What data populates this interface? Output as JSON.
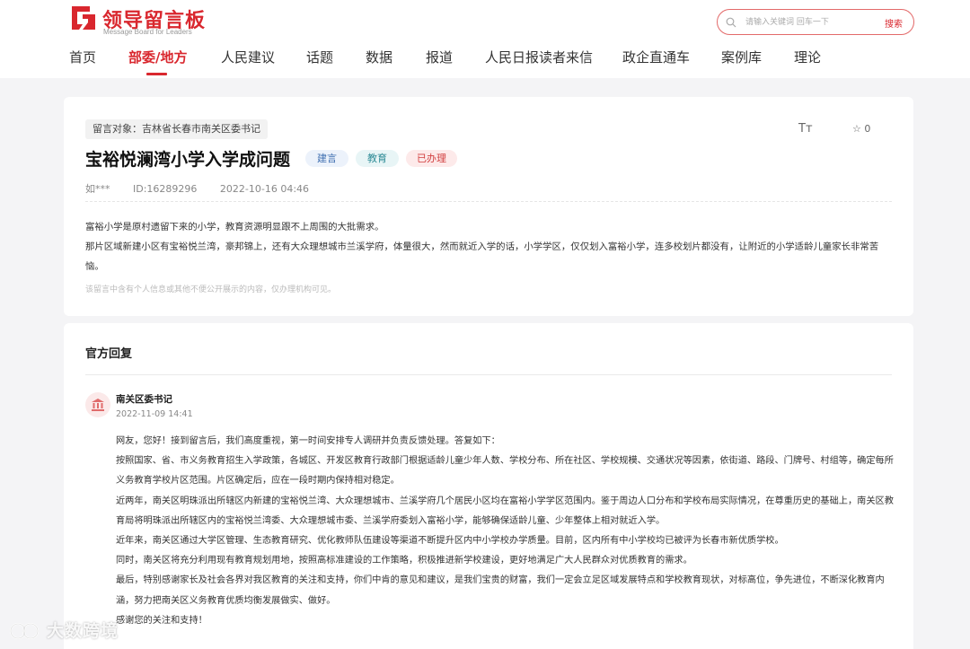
{
  "brand": {
    "name": "领导留言板",
    "subtitle": "Message Board for Leaders",
    "color": "#d9272e"
  },
  "search": {
    "placeholder": "请输入关键词 回车一下",
    "button": "搜索"
  },
  "nav": {
    "items": [
      "首页",
      "部委/地方",
      "人民建议",
      "话题",
      "数据",
      "报道",
      "人民日报读者来信",
      "政企直通车",
      "案例库",
      "理论"
    ],
    "active": "部委/地方"
  },
  "message": {
    "target": "留言对象：吉林省长春市南关区委书记",
    "font_size_icon": "Tт",
    "star_count": "☆ 0",
    "title": "宝裕悦澜湾小学入学成问题",
    "tags": [
      "建言",
      "教育",
      "已办理"
    ],
    "author": "如***",
    "id": "ID:16289296",
    "time": "2022-10-16 04:46",
    "paragraphs": [
      "富裕小学是原村遗留下来的小学，教育资源明显跟不上周围的大批需求。",
      "那片区域新建小区有宝裕悦兰湾，豪邦锦上，还有大众理想城市兰溪学府，体量很大，然而就近入学的话，小学学区，仅仅划入富裕小学，连多校划片都没有，让附近的小学适龄儿童家长非常苦恼。"
    ],
    "privacy_note": "该留言中含有个人信息或其他不便公开展示的内容，仅办理机构可见。"
  },
  "reply": {
    "section_title": "官方回复",
    "replier": "南关区委书记",
    "time": "2022-11-09 14:41",
    "paragraphs": [
      "网友，您好！接到留言后，我们高度重视，第一时间安排专人调研并负责反馈处理。答复如下：",
      "按照国家、省、市义务教育招生入学政策，各城区、开发区教育行政部门根据适龄儿童少年人数、学校分布、所在社区、学校规模、交通状况等因素，依街道、路段、门牌号、村组等，确定每所义务教育学校片区范围。片区确定后，应在一段时期内保持相对稳定。",
      "近两年，南关区明珠派出所辖区内新建的宝裕悦兰湾、大众理想城市、兰溪学府几个居民小区均在富裕小学学区范围内。鉴于周边人口分布和学校布局实际情况，在尊重历史的基础上，南关区教育局将明珠派出所辖区内的宝裕悦兰湾委、大众理想城市委、兰溪学府委划入富裕小学，能够确保适龄儿童、少年整体上相对就近入学。",
      "近年来，南关区通过大学区管理、生态教育研究、优化教师队伍建设等渠道不断提升区内中小学校办学质量。目前，区内所有中小学校均已被评为长春市新优质学校。",
      "同时，南关区将充分利用现有教育规划用地，按照高标准建设的工作策略，积极推进新学校建设，更好地满足广大人民群众对优质教育的需求。",
      "最后，特别感谢家长及社会各界对我区教育的关注和支持，你们中肯的意见和建议，是我们宝贵的财富，我们一定会立足区域发展特点和学校教育现状，对标高位，争先进位，不断深化教育内涵，努力把南关区义务教育优质均衡发展做实、做好。",
      "感谢您的关注和支持！"
    ]
  },
  "watermark": "大数跨境"
}
